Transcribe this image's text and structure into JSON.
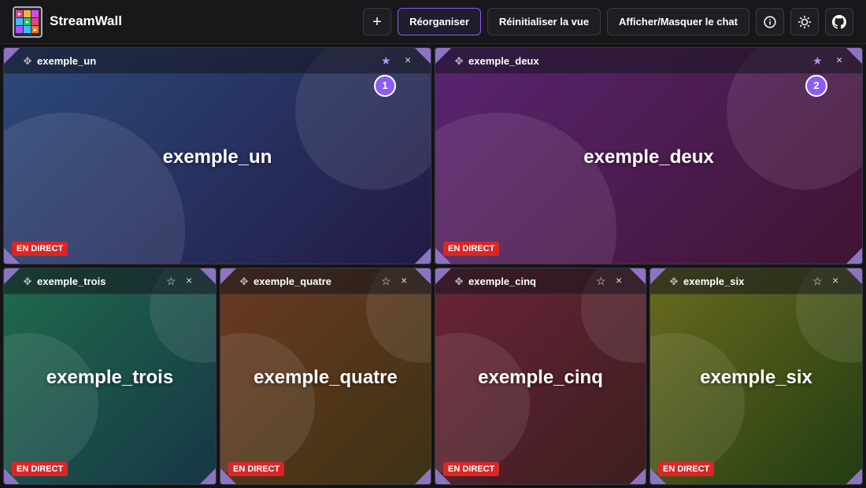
{
  "app": {
    "title": "StreamWall"
  },
  "toolbar": {
    "add_label": "+",
    "reorganize_label": "Réorganiser",
    "reset_view_label": "Réinitialiser la vue",
    "toggle_chat_label": "Afficher/Masquer le chat",
    "info_icon": "info-icon",
    "theme_icon": "sun-icon",
    "github_icon": "github-icon"
  },
  "colors": {
    "accent": "#8b5cf6",
    "live": "#dc2626"
  },
  "streams": [
    {
      "name": "exemple_un",
      "live_label": "EN DIRECT",
      "favorite": true,
      "badge": "1",
      "gradient": [
        "#2c4a7a",
        "#231a46"
      ]
    },
    {
      "name": "exemple_deux",
      "live_label": "EN DIRECT",
      "favorite": true,
      "badge": "2",
      "gradient": [
        "#5a2472",
        "#401432"
      ]
    },
    {
      "name": "exemple_trois",
      "live_label": "EN DIRECT",
      "favorite": false,
      "badge": "",
      "gradient": [
        "#1f6b4c",
        "#173646"
      ]
    },
    {
      "name": "exemple_quatre",
      "live_label": "EN DIRECT",
      "favorite": false,
      "badge": "",
      "gradient": [
        "#6a3a22",
        "#3d3214"
      ]
    },
    {
      "name": "exemple_cinq",
      "live_label": "EN DIRECT",
      "favorite": false,
      "badge": "",
      "gradient": [
        "#6a2436",
        "#3c1e20"
      ]
    },
    {
      "name": "exemple_six",
      "live_label": "EN DIRECT",
      "favorite": false,
      "badge": "",
      "gradient": [
        "#6a6a1e",
        "#213c12"
      ]
    }
  ]
}
